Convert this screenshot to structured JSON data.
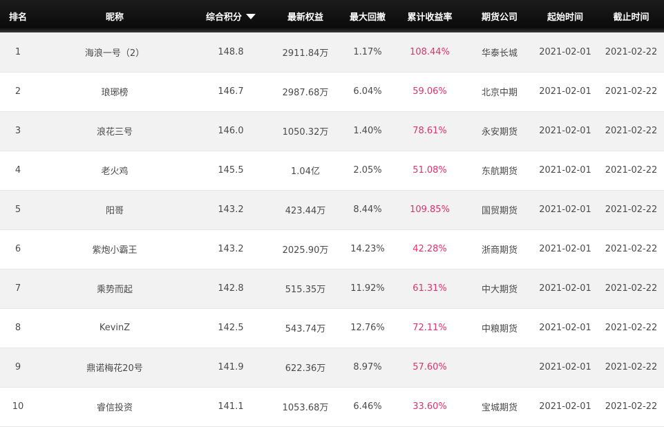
{
  "table": {
    "columns": [
      "排名",
      "昵称",
      "综合积分",
      "最新权益",
      "最大回撤",
      "累计收益率",
      "期货公司",
      "起始时间",
      "截止时间"
    ],
    "sort_indicator": "triangle-down-icon",
    "accent_colors": {
      "yield": "#e1306c",
      "header_bg": "#111111"
    },
    "rows": [
      {
        "rank": "1",
        "nickname": "海浪一号（2）",
        "score": "148.8",
        "equity": "2911.84万",
        "drawdown": "1.17%",
        "yield": "108.44%",
        "company": "华泰长城",
        "start": "2021-02-01",
        "end": "2021-02-22"
      },
      {
        "rank": "2",
        "nickname": "琅琊榜",
        "score": "146.7",
        "equity": "2987.68万",
        "drawdown": "6.04%",
        "yield": "59.06%",
        "company": "北京中期",
        "start": "2021-02-01",
        "end": "2021-02-22"
      },
      {
        "rank": "3",
        "nickname": "浪花三号",
        "score": "146.0",
        "equity": "1050.32万",
        "drawdown": "1.40%",
        "yield": "78.61%",
        "company": "永安期货",
        "start": "2021-02-01",
        "end": "2021-02-22"
      },
      {
        "rank": "4",
        "nickname": "老火鸡",
        "score": "145.5",
        "equity": "1.04亿",
        "drawdown": "2.05%",
        "yield": "51.08%",
        "company": "东航期货",
        "start": "2021-02-01",
        "end": "2021-02-22"
      },
      {
        "rank": "5",
        "nickname": "阳哥",
        "score": "143.2",
        "equity": "423.44万",
        "drawdown": "8.44%",
        "yield": "109.85%",
        "company": "国贸期货",
        "start": "2021-02-01",
        "end": "2021-02-22"
      },
      {
        "rank": "6",
        "nickname": "紫炮小霸王",
        "score": "143.2",
        "equity": "2025.90万",
        "drawdown": "14.23%",
        "yield": "42.28%",
        "company": "浙商期货",
        "start": "2021-02-01",
        "end": "2021-02-22"
      },
      {
        "rank": "7",
        "nickname": "乘势而起",
        "score": "142.8",
        "equity": "515.35万",
        "drawdown": "11.92%",
        "yield": "61.31%",
        "company": "中大期货",
        "start": "2021-02-01",
        "end": "2021-02-22"
      },
      {
        "rank": "8",
        "nickname": "KevinZ",
        "score": "142.5",
        "equity": "543.74万",
        "drawdown": "12.76%",
        "yield": "72.11%",
        "company": "中粮期货",
        "start": "2021-02-01",
        "end": "2021-02-22"
      },
      {
        "rank": "9",
        "nickname": "鼎诺梅花20号",
        "score": "141.9",
        "equity": "622.36万",
        "drawdown": "8.97%",
        "yield": "57.60%",
        "company": "",
        "start": "2021-02-01",
        "end": "2021-02-22"
      },
      {
        "rank": "10",
        "nickname": "睿信投资",
        "score": "141.1",
        "equity": "1053.68万",
        "drawdown": "6.46%",
        "yield": "33.60%",
        "company": "宝城期货",
        "start": "2021-02-01",
        "end": "2021-02-22"
      }
    ]
  }
}
